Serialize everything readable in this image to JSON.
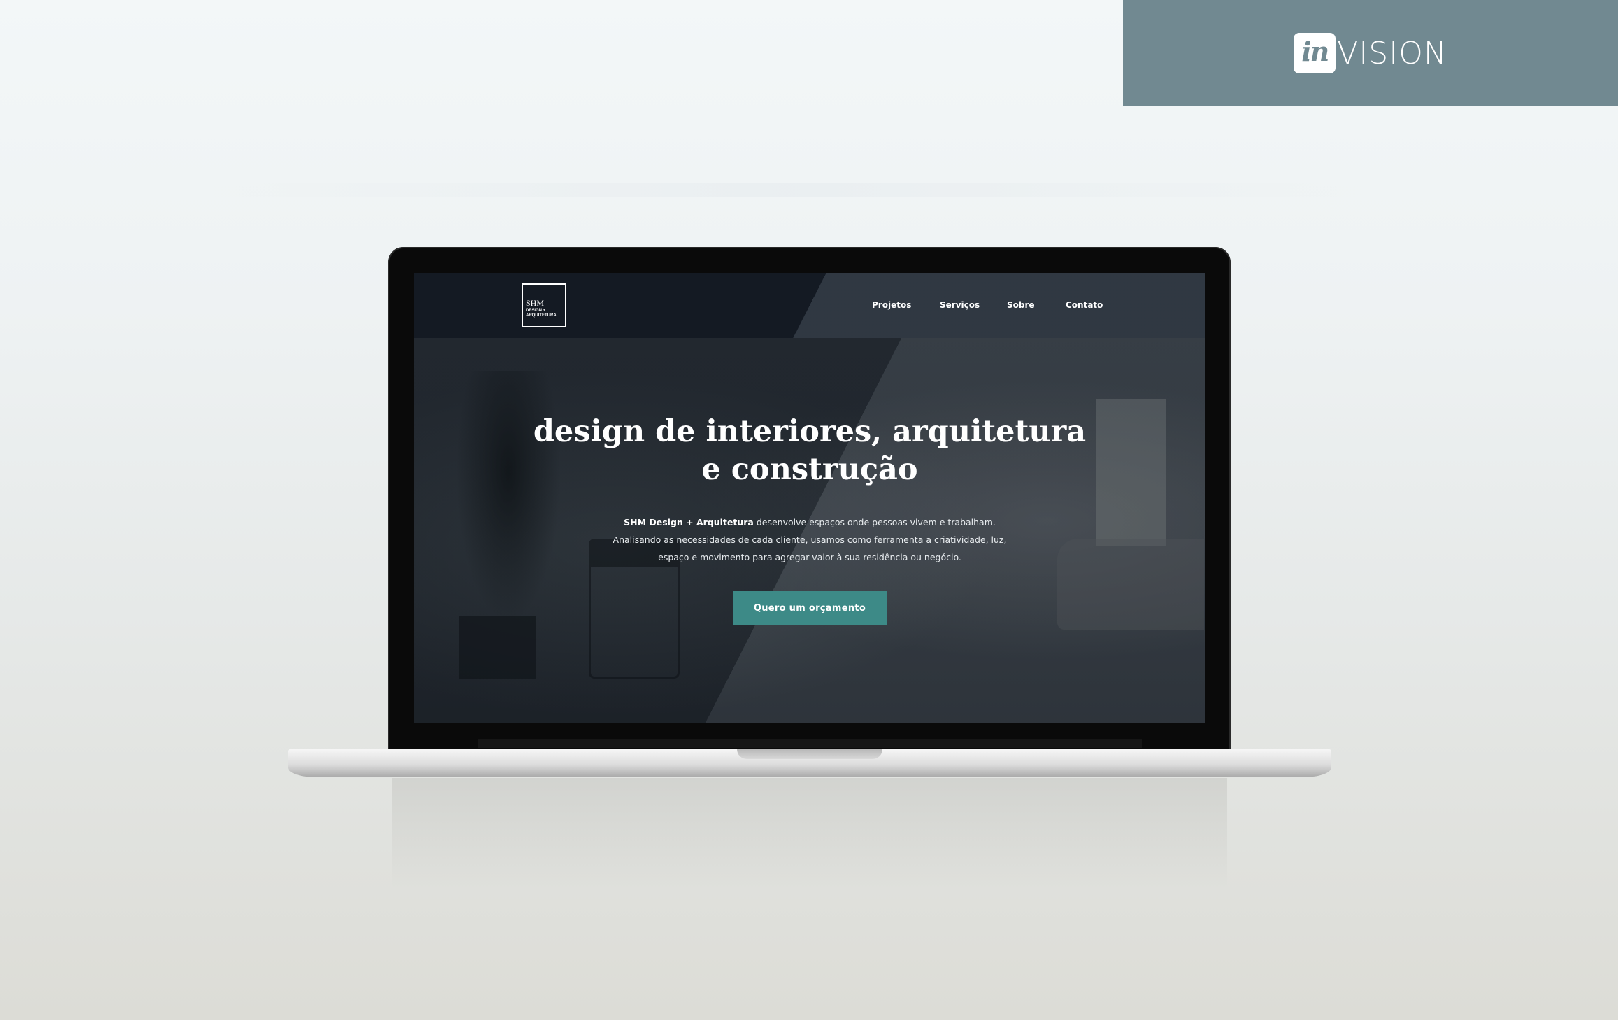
{
  "badge": {
    "logo_in": "in",
    "logo_vision": "VISION",
    "color": "#718991"
  },
  "site": {
    "brand": {
      "name": "SHM",
      "line1": "DESIGN +",
      "line2": "ARQUITETURA"
    },
    "nav": [
      "Projetos",
      "Serviços",
      "Sobre",
      "Contato"
    ],
    "headline": "design de interiores, arquitetura e construção",
    "intro": {
      "bold": "SHM Design + Arquitetura",
      "rest1": " desenvolve espaços onde pessoas vivem e trabalham.",
      "line2": "Analisando as necessidades de cada cliente, usamos como ferramenta a criatividade, luz,",
      "line3": "espaço e movimento para agregar valor à sua residência ou negócio."
    },
    "cta": "Quero um orçamento",
    "accent_color": "#3d8a87",
    "nav_bg": "#141a23"
  }
}
